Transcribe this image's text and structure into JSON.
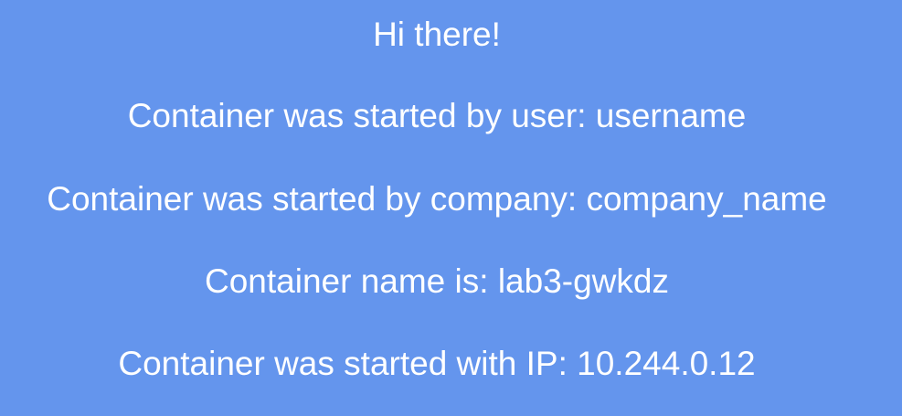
{
  "colors": {
    "background": "#6495ED",
    "text": "#FFFFFF"
  },
  "lines": {
    "greeting": "Hi there!",
    "started_by_user": "Container was started by user: username",
    "started_by_company": "Container was started by company: company_name",
    "container_name": "Container name is: lab3-gwkdz",
    "started_with_ip": "Container was started with IP: 10.244.0.12"
  }
}
